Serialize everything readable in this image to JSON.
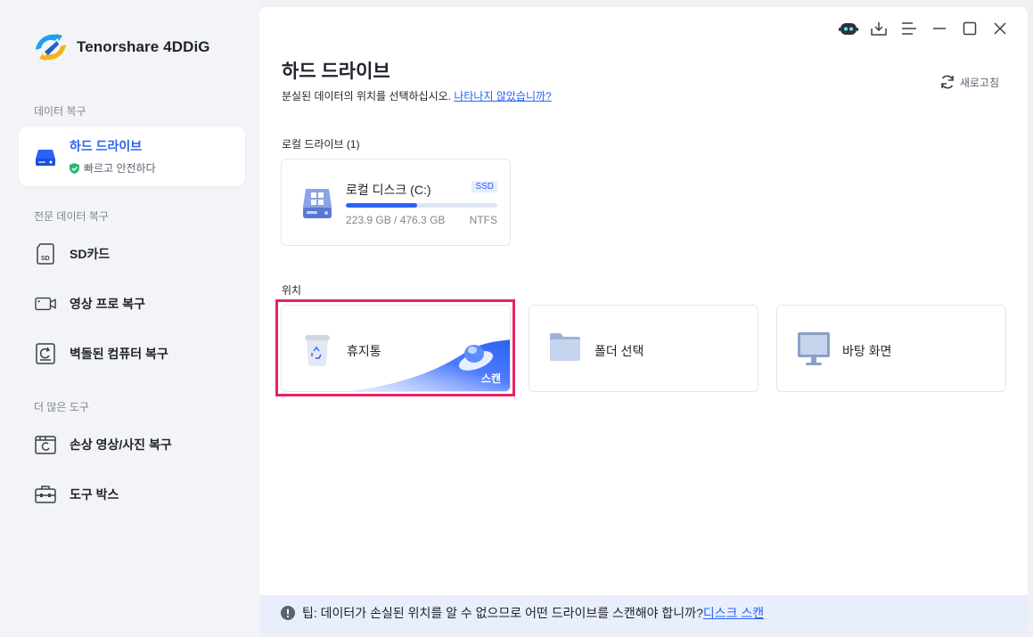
{
  "app": {
    "name": "Tenorshare 4DDiG"
  },
  "sidebar": {
    "section_recovery": "데이터 복구",
    "section_pro": "전문 데이터 복구",
    "section_more": "더 많은 도구",
    "active_item": {
      "label": "하드 드라이브",
      "badge": "빠르고 안전하다"
    },
    "pro_items": [
      {
        "label": "SD카드",
        "icon": "sd-card-icon"
      },
      {
        "label": "영상 프로 복구",
        "icon": "video-camera-icon"
      },
      {
        "label": "벽돌된 컴퓨터 복구",
        "icon": "crashed-computer-icon"
      }
    ],
    "more_items": [
      {
        "label": "손상 영상/사진 복구",
        "icon": "photo-repair-icon"
      },
      {
        "label": "도구 박스",
        "icon": "toolbox-icon"
      }
    ]
  },
  "header": {
    "title": "하드 드라이브",
    "subtitle": "분실된 데이터의 위치를 선택하십시오.",
    "subtitle_link": "나타나지 않았습니까?",
    "refresh": "새로고침"
  },
  "local_drives": {
    "label": "로컬 드라이브 (1)",
    "drives": [
      {
        "name": "로컬 디스크 (C:)",
        "type": "SSD",
        "used": "223.9 GB",
        "total": "476.3 GB",
        "size_text": "223.9 GB / 476.3 GB",
        "fs": "NTFS",
        "usage_fraction": 0.47
      }
    ]
  },
  "locations": {
    "label": "위치",
    "items": [
      {
        "label": "휴지통",
        "action": "스캔",
        "icon": "recycle-bin-icon"
      },
      {
        "label": "폴더 선택",
        "icon": "folder-icon"
      },
      {
        "label": "바탕 화면",
        "icon": "desktop-icon"
      }
    ]
  },
  "tip": {
    "text": "팁: 데이터가 손실된 위치를 알 수 없으므로 어떤 드라이브를 스캔해야 합니까?",
    "link": "디스크 스캔"
  },
  "colors": {
    "accent": "#2a62f5",
    "highlight": "#e5216b",
    "tip_bg": "#e8eefb"
  }
}
